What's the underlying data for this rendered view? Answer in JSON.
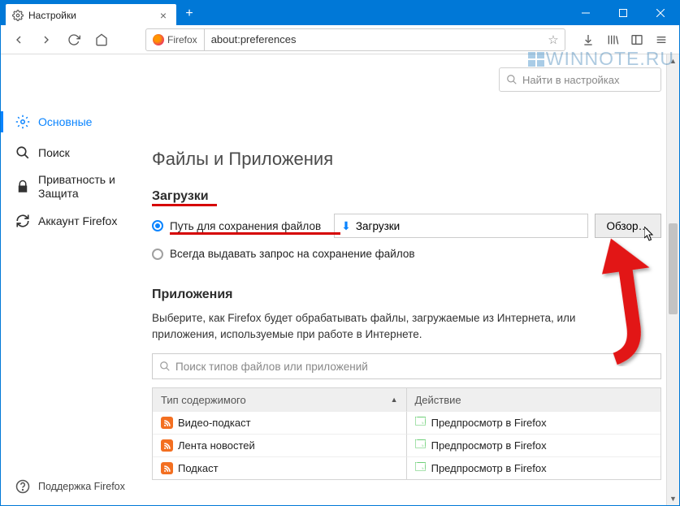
{
  "tab": {
    "title": "Настройки"
  },
  "urlbar": {
    "identity": "Firefox",
    "url": "about:preferences"
  },
  "watermark": "WINNOTE.RU",
  "settings_search": {
    "placeholder": "Найти в настройках"
  },
  "sidebar": {
    "items": [
      {
        "label": "Основные"
      },
      {
        "label": "Поиск"
      },
      {
        "label": "Приватность и Защита"
      },
      {
        "label": "Аккаунт Firefox"
      }
    ],
    "support": "Поддержка Firefox"
  },
  "main": {
    "section_title": "Файлы и Приложения",
    "downloads": {
      "heading": "Загрузки",
      "save_to_label": "Путь для сохранения файлов",
      "folder": "Загрузки",
      "browse": "Обзор…",
      "always_ask": "Всегда выдавать запрос на сохранение файлов"
    },
    "apps": {
      "heading": "Приложения",
      "desc": "Выберите, как Firefox будет обрабатывать файлы, загружаемые из Интернета, или приложения, используемые при работе в Интернете.",
      "search_placeholder": "Поиск типов файлов или приложений",
      "col_type": "Тип содержимого",
      "col_action": "Действие",
      "rows": [
        {
          "type": "Видео-подкаст",
          "action": "Предпросмотр в Firefox"
        },
        {
          "type": "Лента новостей",
          "action": "Предпросмотр в Firefox"
        },
        {
          "type": "Подкаст",
          "action": "Предпросмотр в Firefox"
        }
      ]
    }
  }
}
